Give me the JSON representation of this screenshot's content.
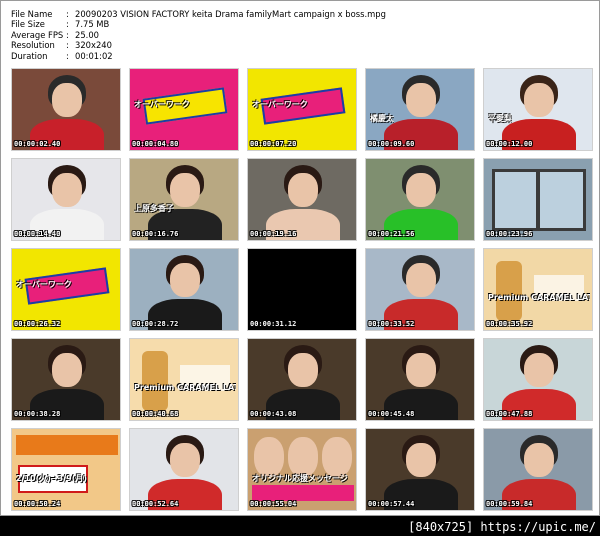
{
  "info": {
    "rows": [
      {
        "key": "File Name",
        "value": "20090203 VISION FACTORY keita Drama familyMart campaign x boss.mpg"
      },
      {
        "key": "File Size",
        "value": "7.75 MB"
      },
      {
        "key": "Average FPS",
        "value": "25.00"
      },
      {
        "key": "Resolution",
        "value": "320x240"
      },
      {
        "key": "Duration",
        "value": "00:01:02"
      }
    ],
    "separator": ":"
  },
  "thumbs": [
    {
      "time": "00:00:02.40",
      "bg": "#7a4a3a",
      "scene": "person",
      "c1": "#c8202a",
      "c2": "#2a2a2a",
      "caption": ""
    },
    {
      "time": "00:00:04.80",
      "bg": "#e8207a",
      "scene": "logo",
      "c1": "#f7e400",
      "c2": "#1a3fa6",
      "caption": "オーバーワーク"
    },
    {
      "time": "00:00:07.20",
      "bg": "#f2e600",
      "scene": "logo",
      "c1": "#e8207a",
      "c2": "#1a3fa6",
      "caption": "オーバーワーク"
    },
    {
      "time": "00:00:09.60",
      "bg": "#8aa7c2",
      "scene": "person",
      "c1": "#b8202a",
      "c2": "#2a2a2a",
      "caption": "橘慶太"
    },
    {
      "time": "00:00:12.00",
      "bg": "#dfe6ee",
      "scene": "person",
      "c1": "#c82020",
      "c2": "#3a2418",
      "caption": "平愛梨"
    },
    {
      "time": "00:00:14.40",
      "bg": "#e6e6ea",
      "scene": "person",
      "c1": "#f2f2f2",
      "c2": "#2a1a14",
      "caption": ""
    },
    {
      "time": "00:00:16.76",
      "bg": "#b8a882",
      "scene": "person",
      "c1": "#222222",
      "c2": "#2a1a14",
      "caption": "上原多香子"
    },
    {
      "time": "00:00:19.16",
      "bg": "#6e6a62",
      "scene": "person",
      "c1": "#eac8b0",
      "c2": "#2a1a14",
      "caption": ""
    },
    {
      "time": "00:00:21.56",
      "bg": "#7f8f70",
      "scene": "person",
      "c1": "#28c028",
      "c2": "#2a2a2a",
      "caption": ""
    },
    {
      "time": "00:00:23.96",
      "bg": "#8aa0b0",
      "scene": "building",
      "c1": "#3a3a3a",
      "c2": "#bcd0de",
      "caption": ""
    },
    {
      "time": "00:00:26.32",
      "bg": "#f2e600",
      "scene": "logo",
      "c1": "#e8207a",
      "c2": "#1a3fa6",
      "caption": "オーバーワーク"
    },
    {
      "time": "00:00:28.72",
      "bg": "#9cb0c0",
      "scene": "person",
      "c1": "#1a1a1a",
      "c2": "#2a1a14",
      "caption": ""
    },
    {
      "time": "00:00:31.12",
      "bg": "#000000",
      "scene": "black",
      "c1": "#000000",
      "c2": "#000000",
      "caption": ""
    },
    {
      "time": "00:00:33.52",
      "bg": "#a8b8c8",
      "scene": "person",
      "c1": "#c82a2a",
      "c2": "#2a2a2a",
      "caption": ""
    },
    {
      "time": "00:00:35.92",
      "bg": "#f2d8a6",
      "scene": "product",
      "c1": "#d8a04a",
      "c2": "#ffffff",
      "caption": "Premium CARAMEL LATTE"
    },
    {
      "time": "00:00:38.28",
      "bg": "#4a3a2a",
      "scene": "person",
      "c1": "#1a1a1a",
      "c2": "#2a1a14",
      "caption": ""
    },
    {
      "time": "00:00:40.68",
      "bg": "#f6dcac",
      "scene": "product",
      "c1": "#d8a04a",
      "c2": "#ffffff",
      "caption": "Premium CARAMEL LATTE"
    },
    {
      "time": "00:00:43.08",
      "bg": "#4a3a2a",
      "scene": "person",
      "c1": "#1a1a1a",
      "c2": "#2a1a14",
      "caption": ""
    },
    {
      "time": "00:00:45.48",
      "bg": "#4a3a2a",
      "scene": "person",
      "c1": "#1a1a1a",
      "c2": "#2a1a14",
      "caption": ""
    },
    {
      "time": "00:00:47.88",
      "bg": "#c8d6d8",
      "scene": "person",
      "c1": "#d02a2a",
      "c2": "#2a1a14",
      "caption": ""
    },
    {
      "time": "00:00:50.24",
      "bg": "#f2c888",
      "scene": "campaign",
      "c1": "#e87a1a",
      "c2": "#d01a1a",
      "caption": "2/10(火)→3/9(月)"
    },
    {
      "time": "00:00:52.64",
      "bg": "#e2e4e8",
      "scene": "person",
      "c1": "#d02a2a",
      "c2": "#2a1a14",
      "caption": ""
    },
    {
      "time": "00:00:55.04",
      "bg": "#caa070",
      "scene": "campaign2",
      "c1": "#e8207a",
      "c2": "#f2e600",
      "caption": "オリジナル応援メッセージ"
    },
    {
      "time": "00:00:57.44",
      "bg": "#4a3a2a",
      "scene": "person",
      "c1": "#1a1a1a",
      "c2": "#2a1a14",
      "caption": ""
    },
    {
      "time": "00:00:59.84",
      "bg": "#8a9aa8",
      "scene": "person",
      "c1": "#c82a2a",
      "c2": "#2a2a2a",
      "caption": ""
    }
  ],
  "footer": {
    "text": "[840x725] https://upic.me/"
  }
}
